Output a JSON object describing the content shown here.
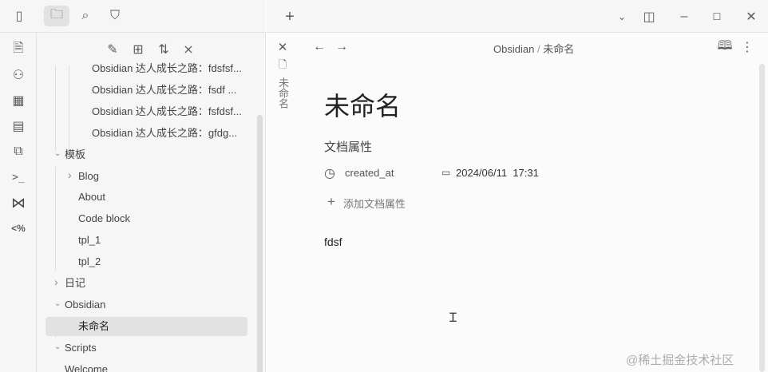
{
  "topbar": {
    "icons": [
      "sidebar-toggle-icon",
      "folder-icon",
      "search-icon",
      "bookmark-icon"
    ]
  },
  "ribbon": {
    "icons": [
      "search-file-icon",
      "graph-icon",
      "canvas-icon",
      "calendar-icon",
      "copy-icon",
      "terminal-icon",
      "vscode-icon",
      "templater-icon"
    ],
    "terminal_label": ">_",
    "templater_label": "<%"
  },
  "explorer": {
    "items": [
      {
        "label": "Obsidian 达人成长之路：fdsfsf...",
        "level": 2
      },
      {
        "label": "Obsidian 达人成长之路：fsdf ...",
        "level": 2
      },
      {
        "label": "Obsidian 达人成长之路：fsfdsf...",
        "level": 2
      },
      {
        "label": "Obsidian 达人成长之路：gfdg...",
        "level": 2
      },
      {
        "label": "模板",
        "level": 0,
        "chevron": "down"
      },
      {
        "label": "Blog",
        "level": 1,
        "chevron": "right"
      },
      {
        "label": "About",
        "level": 1
      },
      {
        "label": "Code block",
        "level": 1
      },
      {
        "label": "tpl_1",
        "level": 1
      },
      {
        "label": "tpl_2",
        "level": 1
      },
      {
        "label": "日记",
        "level": 0,
        "chevron": "right"
      },
      {
        "label": "Obsidian",
        "level": 0,
        "chevron": "down"
      },
      {
        "label": "未命名",
        "level": 1,
        "selected": true
      },
      {
        "label": "Scripts",
        "level": 0,
        "chevron": "down"
      },
      {
        "label": "Welcome",
        "level": 0
      }
    ]
  },
  "tab": {
    "new_tab": "+",
    "vertical_title": "未命名"
  },
  "header": {
    "breadcrumb_folder": "Obsidian",
    "separator": "/",
    "breadcrumb_file": "未命名"
  },
  "note": {
    "title": "未命名",
    "properties_heading": "文档属性",
    "property_key": "created_at",
    "property_value": "2024/06/11  17:31",
    "add_property": "添加文档属性",
    "body": "fdsf"
  },
  "watermark": "@稀土掘金技术社区"
}
